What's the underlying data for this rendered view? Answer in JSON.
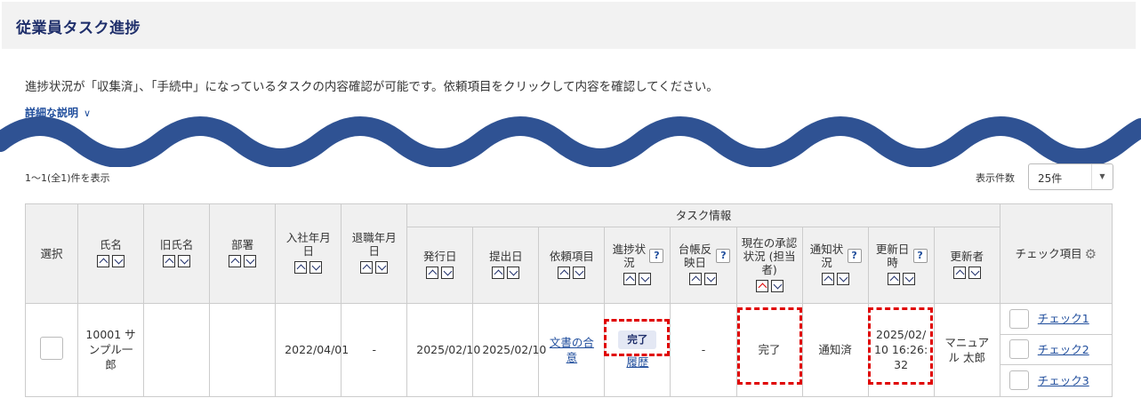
{
  "page": {
    "title": "従業員タスク進捗",
    "description": "進捗状況が「収集済」、「手続中」になっているタスクの内容確認が可能です。依頼項目をクリックして内容を確認してください。",
    "detail_link": "詳細な説明",
    "count_text": "1〜1(全1)件を表示",
    "per_page_label": "表示件数",
    "per_page_value": "25件"
  },
  "table": {
    "group_header": "タスク情報",
    "headers": {
      "select": "選択",
      "name": "氏名",
      "old_name": "旧氏名",
      "department": "部署",
      "hire_date": "入社年月日",
      "leave_date": "退職年月日",
      "issue_date": "発行日",
      "submit_date": "提出日",
      "request_item": "依頼項目",
      "progress": "進捗状況",
      "ledger": "台帳反映日",
      "approval": "現在の承認状況 (担当者)",
      "notify": "通知状況",
      "updated_at": "更新日時",
      "updater": "更新者",
      "check_items": "チェック項目"
    },
    "row": {
      "name": "10001 サンプル一郎",
      "old_name": "",
      "department": "",
      "hire_date": "2022/04/01",
      "leave_date": "-",
      "issue_date": "2025/02/10",
      "submit_date": "2025/02/10",
      "request_item": "文書の合意",
      "progress_status": "完了",
      "progress_history": "履歴",
      "ledger": "-",
      "approval": "完了",
      "notify": "通知済",
      "updated_at": "2025/02/10 16:26:32",
      "updater": "マニュアル 太郎",
      "checks": [
        "チェック1",
        "チェック2",
        "チェック3"
      ]
    }
  },
  "colors": {
    "title": "#1f2f6b",
    "link": "#1f4d9c",
    "wave": "#2f5293",
    "highlight": "#e00000"
  }
}
